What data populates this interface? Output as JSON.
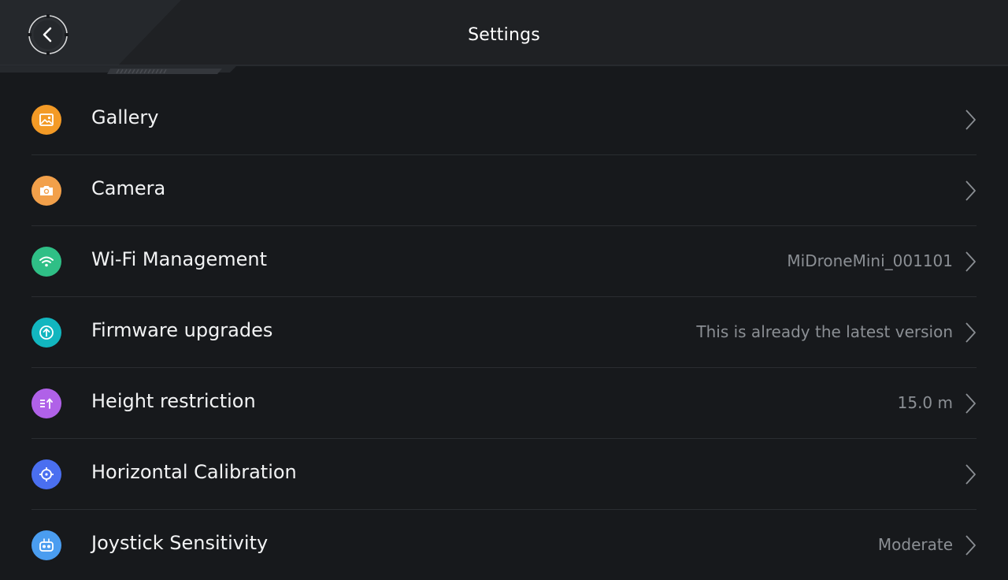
{
  "header": {
    "title": "Settings",
    "back_icon": "chevron-left-icon"
  },
  "settings": {
    "items": [
      {
        "label": "Gallery",
        "value": "",
        "icon": "gallery-icon",
        "color": "#f39a26"
      },
      {
        "label": "Camera",
        "value": "",
        "icon": "camera-icon",
        "color": "#f2a04a"
      },
      {
        "label": "Wi-Fi Management",
        "value": "MiDroneMini_001101",
        "icon": "wifi-icon",
        "color": "#2fbf86"
      },
      {
        "label": "Firmware upgrades",
        "value": "This is already the latest version",
        "icon": "upload-icon",
        "color": "#12b6bf"
      },
      {
        "label": "Height restriction",
        "value": "15.0 m",
        "icon": "height-icon",
        "color": "#b061e8"
      },
      {
        "label": "Horizontal Calibration",
        "value": "",
        "icon": "crosshair-icon",
        "color": "#4a6ff0"
      },
      {
        "label": "Joystick Sensitivity",
        "value": "Moderate",
        "icon": "joystick-icon",
        "color": "#4a9df0"
      }
    ]
  }
}
